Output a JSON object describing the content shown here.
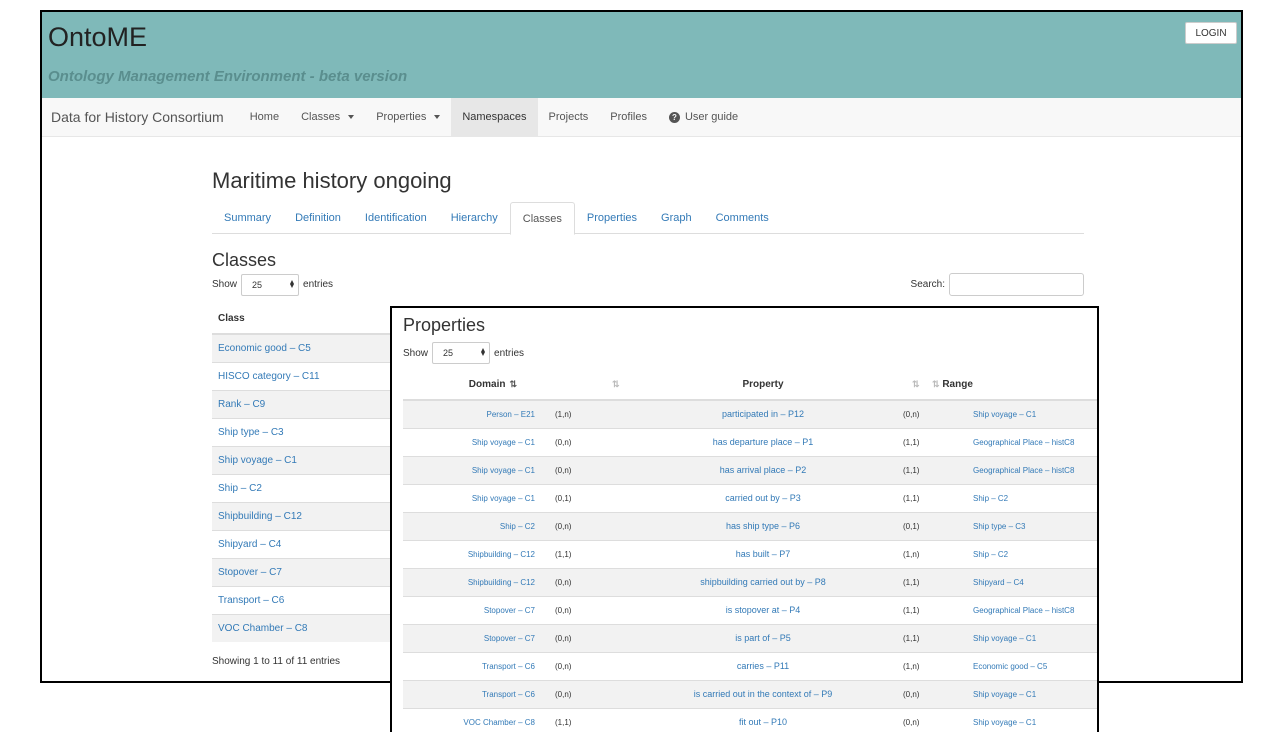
{
  "app": {
    "title": "OntoME",
    "subtitle": "Ontology Management Environment - beta version",
    "login_label": "LOGIN"
  },
  "navbar": {
    "brand": "Data for History Consortium",
    "items": [
      {
        "label": "Home"
      },
      {
        "label": "Classes"
      },
      {
        "label": "Properties"
      },
      {
        "label": "Namespaces"
      },
      {
        "label": "Projects"
      },
      {
        "label": "Profiles"
      },
      {
        "label": "User guide"
      }
    ]
  },
  "page": {
    "title": "Maritime history ongoing",
    "tabs": [
      "Summary",
      "Definition",
      "Identification",
      "Hierarchy",
      "Classes",
      "Properties",
      "Graph",
      "Comments"
    ]
  },
  "classes": {
    "heading": "Classes",
    "show_label": "Show",
    "entries_label": "entries",
    "page_length": "25",
    "search_label": "Search:",
    "search_value": "",
    "column_header": "Class",
    "rows": [
      "Economic good – C5",
      "HISCO category – C11",
      "Rank – C9",
      "Ship type – C3",
      "Ship voyage – C1",
      "Ship – C2",
      "Shipbuilding – C12",
      "Shipyard – C4",
      "Stopover – C7",
      "Transport – C6",
      "VOC Chamber – C8"
    ],
    "info": "Showing 1 to 11 of 11 entries"
  },
  "properties": {
    "heading": "Properties",
    "show_label": "Show",
    "entries_label": "entries",
    "page_length": "25",
    "headers": {
      "domain": "Domain",
      "property": "Property",
      "range": "Range"
    },
    "rows": [
      {
        "domain": "Person – E21",
        "dcard": "(1,n)",
        "property": "participated in – P12",
        "rcard": "(0,n)",
        "range": "Ship voyage – C1"
      },
      {
        "domain": "Ship voyage – C1",
        "dcard": "(0,n)",
        "property": "has departure place – P1",
        "rcard": "(1,1)",
        "range": "Geographical Place – histC8"
      },
      {
        "domain": "Ship voyage – C1",
        "dcard": "(0,n)",
        "property": "has arrival place – P2",
        "rcard": "(1,1)",
        "range": "Geographical Place – histC8"
      },
      {
        "domain": "Ship voyage – C1",
        "dcard": "(0,1)",
        "property": "carried out by – P3",
        "rcard": "(1,1)",
        "range": "Ship – C2"
      },
      {
        "domain": "Ship – C2",
        "dcard": "(0,n)",
        "property": "has ship type – P6",
        "rcard": "(0,1)",
        "range": "Ship type – C3"
      },
      {
        "domain": "Shipbuilding – C12",
        "dcard": "(1,1)",
        "property": "has built – P7",
        "rcard": "(1,n)",
        "range": "Ship – C2"
      },
      {
        "domain": "Shipbuilding – C12",
        "dcard": "(0,n)",
        "property": "shipbuilding carried out by – P8",
        "rcard": "(1,1)",
        "range": "Shipyard – C4"
      },
      {
        "domain": "Stopover – C7",
        "dcard": "(0,n)",
        "property": "is stopover at – P4",
        "rcard": "(1,1)",
        "range": "Geographical Place – histC8"
      },
      {
        "domain": "Stopover – C7",
        "dcard": "(0,n)",
        "property": "is part of – P5",
        "rcard": "(1,1)",
        "range": "Ship voyage – C1"
      },
      {
        "domain": "Transport – C6",
        "dcard": "(0,n)",
        "property": "carries – P11",
        "rcard": "(1,n)",
        "range": "Economic good – C5"
      },
      {
        "domain": "Transport – C6",
        "dcard": "(0,n)",
        "property": "is carried out in the context of – P9",
        "rcard": "(0,n)",
        "range": "Ship voyage – C1"
      },
      {
        "domain": "VOC Chamber – C8",
        "dcard": "(1,1)",
        "property": "fit out – P10",
        "rcard": "(0,n)",
        "range": "Ship voyage – C1"
      }
    ]
  },
  "icons": {
    "help": "question-circle-icon",
    "sort": "sort-icon",
    "sort_asc": "sort-ascending-icon"
  },
  "colors": {
    "header_bg": "#7fb9b9",
    "link": "#337ab7",
    "stripe": "#f2f2f2"
  }
}
